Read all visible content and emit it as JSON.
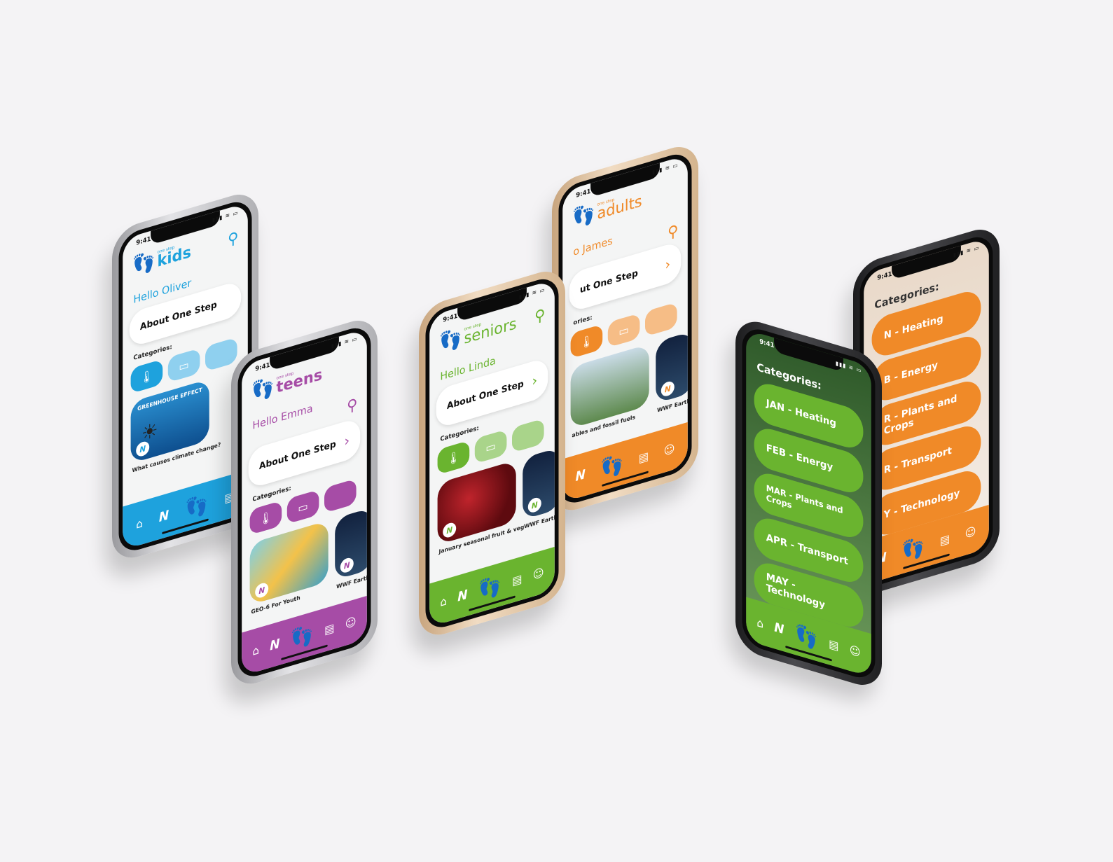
{
  "status": {
    "time": "9:41",
    "signal_icons": "▮▮▮ ≋ ▭"
  },
  "common": {
    "about": "About One Step",
    "categories": "Categories:",
    "n_badge": "N"
  },
  "phones": {
    "kids": {
      "small": "one step",
      "brand": "kids",
      "hello": "Hello Oliver",
      "color": "#1ea2dd",
      "light": "#8fd0ef",
      "card1_caption": "What causes climate change?",
      "card1_banner": "GREENHOUSE EFFECT"
    },
    "teens": {
      "small": "one step",
      "brand": "teens",
      "hello": "Hello Emma",
      "color": "#a64ca6",
      "light": "#a64ca6",
      "card1_caption": "GEO-6 For Youth",
      "card2_caption": "WWF Earth"
    },
    "seniors": {
      "small": "one step",
      "brand": "seniors",
      "hello": "Hello Linda",
      "color": "#6ab42f",
      "light": "#a9d48a",
      "card1_caption": "January seasonal fruit & veg",
      "card2_caption": "WWF Earth"
    },
    "adults": {
      "small": "one step",
      "brand": "adults",
      "hello": "o James",
      "color": "#f08a28",
      "light": "#f6bd86",
      "about": "ut One Step",
      "categories": "ories:",
      "card1_caption": "ables and fossil fuels",
      "card2_caption": "WWF Earth"
    },
    "cat_green": {
      "title": "Categories:",
      "color": "#6ab42f",
      "items": [
        "JAN - Heating",
        "FEB - Energy",
        "MAR - Plants and Crops",
        "APR - Transport",
        "MAY - Technology"
      ]
    },
    "cat_orange": {
      "title": "Categories:",
      "color": "#f08a28",
      "items": [
        "N - Heating",
        "B - Energy",
        "R - Plants and Crops",
        "R - Transport",
        "Y - Technology"
      ]
    }
  },
  "icons": {
    "search": "⚲",
    "thermometer": "🌡",
    "battery": "▭",
    "home": "⌂",
    "chat": "▤",
    "profile": "☺",
    "footprint": "👣"
  }
}
